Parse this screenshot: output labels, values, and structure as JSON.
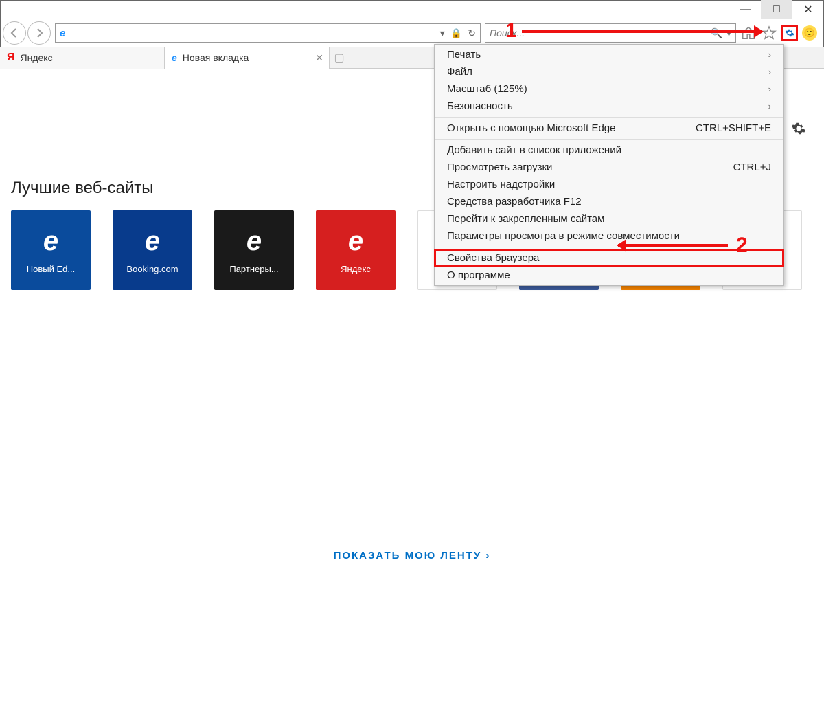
{
  "window": {
    "minimize": "—",
    "maximize": "□",
    "close": "✕"
  },
  "tabs": [
    {
      "icon": "Я",
      "label": "Яндекс"
    },
    {
      "icon": "e",
      "label": "Новая вкладка"
    }
  ],
  "search": {
    "placeholder": "Поиск..."
  },
  "page": {
    "section_title": "Лучшие веб-сайты",
    "feed_link": "ПОКАЗАТЬ МОЮ ЛЕНТУ ›"
  },
  "tiles": [
    {
      "label": "Новый  Ed...",
      "bg": "#0a4b9c"
    },
    {
      "label": "Booking.com",
      "bg": "#083b8c"
    },
    {
      "label": "Партнеры...",
      "bg": "#1a1a1a"
    },
    {
      "label": "Яндекс",
      "bg": "#d61f1f"
    },
    {
      "label": "",
      "bg": "#ffffff"
    },
    {
      "label": "",
      "bg": "#3b5998"
    },
    {
      "label": "",
      "bg": "#f08000"
    },
    {
      "label": "",
      "bg": "#ffffff"
    }
  ],
  "menu": {
    "items_top": [
      {
        "label": "Печать",
        "chev": true
      },
      {
        "label": "Файл",
        "chev": true
      },
      {
        "label": "Масштаб (125%)",
        "chev": true
      },
      {
        "label": "Безопасность",
        "chev": true
      }
    ],
    "edge": {
      "label": "Открыть с помощью Microsoft Edge",
      "shortcut": "CTRL+SHIFT+E"
    },
    "items_mid": [
      {
        "label": "Добавить сайт в список приложений",
        "shortcut": ""
      },
      {
        "label": "Просмотреть загрузки",
        "shortcut": "CTRL+J"
      },
      {
        "label": "Настроить надстройки",
        "shortcut": ""
      },
      {
        "label": "Средства разработчика F12",
        "shortcut": ""
      },
      {
        "label": "Перейти к закрепленным сайтам",
        "shortcut": ""
      },
      {
        "label": "Параметры просмотра в режиме совместимости",
        "shortcut": ""
      }
    ],
    "props": {
      "label": "Свойства браузера"
    },
    "about": {
      "label": "О программе"
    }
  },
  "annotations": {
    "one": "1",
    "two": "2"
  }
}
